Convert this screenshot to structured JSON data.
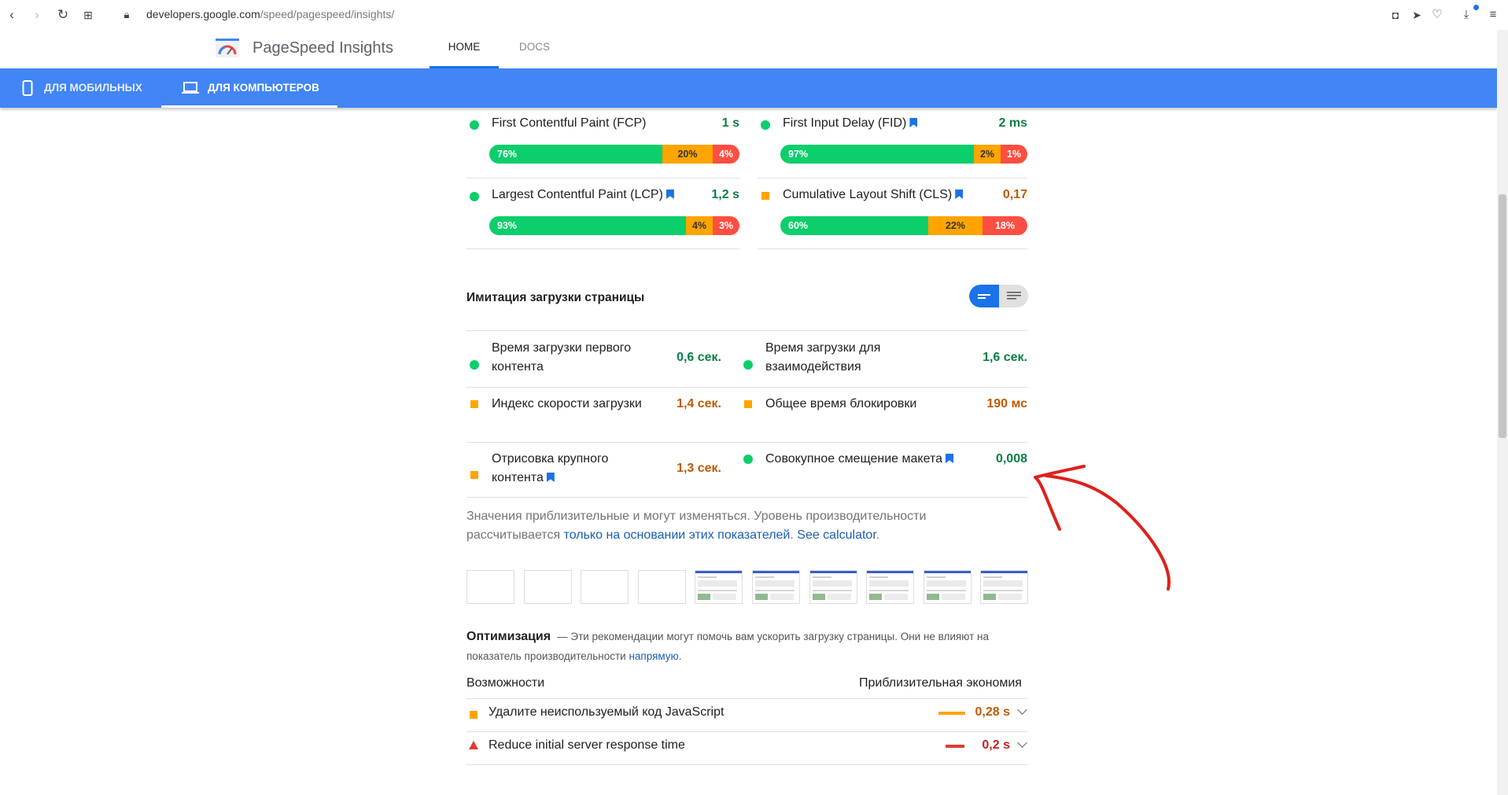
{
  "browser": {
    "url_domain": "developers.google.com",
    "url_path": "/speed/pagespeed/insights/"
  },
  "header": {
    "brand": "PageSpeed Insights",
    "nav": [
      "HOME",
      "DOCS"
    ]
  },
  "tabs": {
    "mobile": "ДЛЯ МОБИЛЬНЫХ",
    "desktop": "ДЛЯ КОМПЬЮТЕРОВ"
  },
  "field_metrics": [
    {
      "label": "First Contentful Paint (FCP)",
      "value": "1 s",
      "status": "good",
      "bookmark": false,
      "dist": {
        "good": "76%",
        "avg": "20%",
        "poor": "4%"
      },
      "fractions": [
        0.76,
        0.2,
        0.04
      ]
    },
    {
      "label": "First Input Delay (FID)",
      "value": "2 ms",
      "status": "good",
      "bookmark": true,
      "dist": {
        "good": "97%",
        "avg": "2%",
        "poor": "1%"
      },
      "fractions": [
        0.97,
        0.02,
        0.01
      ]
    },
    {
      "label": "Largest Contentful Paint (LCP)",
      "value": "1,2 s",
      "status": "good",
      "bookmark": true,
      "dist": {
        "good": "93%",
        "avg": "4%",
        "poor": "3%"
      },
      "fractions": [
        0.93,
        0.04,
        0.03
      ]
    },
    {
      "label": "Cumulative Layout Shift (CLS)",
      "value": "0,17",
      "status": "average",
      "bookmark": true,
      "dist": {
        "good": "60%",
        "avg": "22%",
        "poor": "18%"
      },
      "fractions": [
        0.6,
        0.22,
        0.18
      ]
    }
  ],
  "lab": {
    "title": "Имитация загрузки страницы",
    "metrics": [
      {
        "label": "Время загрузки первого контента",
        "value": "0,6 сек.",
        "status": "good"
      },
      {
        "label": "Время загрузки для взаимодействия",
        "value": "1,6 сек.",
        "status": "good"
      },
      {
        "label": "Индекс скорости загрузки",
        "value": "1,4 сек.",
        "status": "average"
      },
      {
        "label": "Общее время блокировки",
        "value": "190 мс",
        "status": "average"
      },
      {
        "label": "Отрисовка крупного контента",
        "value": "1,3 сек.",
        "status": "average"
      },
      {
        "label": "Совокупное смещение макета",
        "value": "0,008",
        "status": "good"
      }
    ],
    "note_text": "Значения приблизительные и могут изменяться. Уровень производительности рассчитывается ",
    "note_link": "только на основании этих показателей",
    "note_link2": "See calculator",
    "note_end": "."
  },
  "optimization": {
    "title": "Оптимизация",
    "desc": "— Эти рекомендации могут помочь вам ускорить загрузку страницы. Они не влияют на показатель производительности ",
    "link": "напрямую",
    "end": ".",
    "col_left": "Возможности",
    "col_right": "Приблизительная экономия",
    "items": [
      {
        "label": "Удалите неиспользуемый код JavaScript",
        "value": "0,28 s",
        "status": "average"
      },
      {
        "label": "Reduce initial server response time",
        "value": "0,2 s",
        "status": "poor"
      }
    ]
  },
  "colors": {
    "accent": "#4285f4",
    "good": "#0cce6b",
    "average": "#ffa400",
    "poor": "#ff4e42",
    "annotation": "#e0201b"
  }
}
